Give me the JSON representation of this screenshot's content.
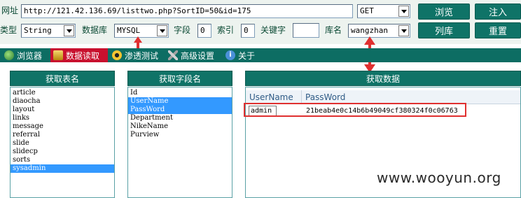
{
  "toolbar": {
    "url_label": "网址",
    "url_value": "http://121.42.136.69/listtwo.php?SortID=50&id=175",
    "method_value": "GET",
    "type_label": "类型",
    "type_value": "String",
    "db_label": "数据库",
    "db_value": "MYSQL",
    "field_label": "字段",
    "field_value": "0",
    "index_label": "索引",
    "index_value": "0",
    "keyword_label": "关键字",
    "keyword_value": "",
    "dbname_label": "库名",
    "dbname_value": "wangzhan",
    "browse_button": "浏览",
    "inject_button": "注入",
    "listdb_button": "列库",
    "reset_button": "重置"
  },
  "tabs": [
    {
      "label": "浏览器"
    },
    {
      "label": "数据读取"
    },
    {
      "label": "渗透测试"
    },
    {
      "label": "高级设置"
    },
    {
      "label": "关于"
    }
  ],
  "tables_panel": {
    "title": "获取表名",
    "items": [
      "article",
      "diaocha",
      "layout",
      "links",
      "message",
      "referral",
      "slide",
      "slidecp",
      "sorts",
      "sysadmin"
    ],
    "selected": "sysadmin"
  },
  "fields_panel": {
    "title": "获取字段名",
    "items": [
      "Id",
      "UserName",
      "PassWord",
      "Department",
      "NikeName",
      "Purview"
    ],
    "selected": [
      "UserName",
      "PassWord"
    ]
  },
  "data_panel": {
    "title": "获取数据",
    "columns": [
      "UserName",
      "PassWord"
    ],
    "rows": [
      {
        "username": "admin",
        "password": "21beab4e0c14b6b49049cf380324f0c06763"
      }
    ]
  },
  "colors": {
    "teal": "#0f7367",
    "tab_active": "#c8102e",
    "selection": "#3399ff",
    "annotation": "#e03030"
  },
  "watermark": "www.wooyun.org"
}
